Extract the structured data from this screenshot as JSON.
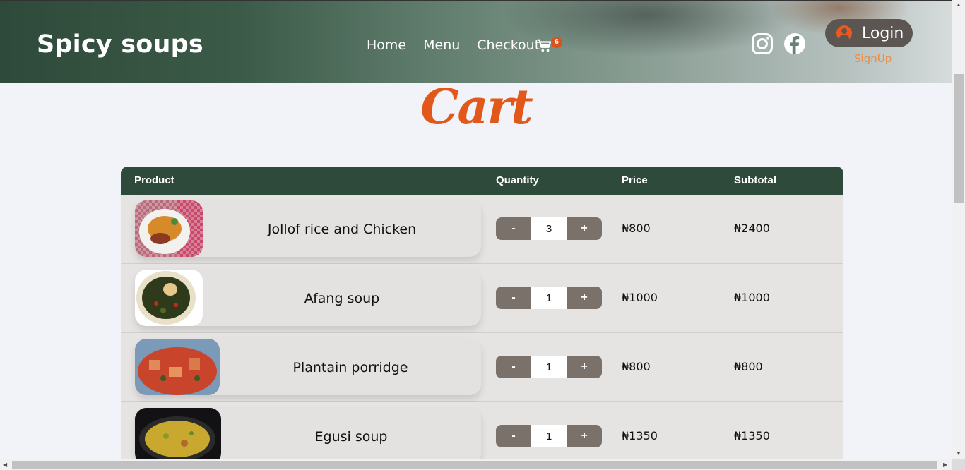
{
  "header": {
    "brand": "Spicy soups",
    "nav": [
      "Home",
      "Menu",
      "Checkout"
    ],
    "cart_count": "6",
    "login_label": "Login",
    "signup_label": "SignUp"
  },
  "page_title": "Cart",
  "table": {
    "headers": {
      "product": "Product",
      "quantity": "Quantity",
      "price": "Price",
      "subtotal": "Subtotal"
    },
    "minus_label": "-",
    "plus_label": "+",
    "rows": [
      {
        "name": "Jollof rice and Chicken",
        "qty": "3",
        "price": "₦800",
        "subtotal": "₦2400"
      },
      {
        "name": "Afang soup",
        "qty": "1",
        "price": "₦1000",
        "subtotal": "₦1000"
      },
      {
        "name": "Plantain porridge",
        "qty": "1",
        "price": "₦800",
        "subtotal": "₦800"
      },
      {
        "name": "Egusi soup",
        "qty": "1",
        "price": "₦1350",
        "subtotal": "₦1350"
      }
    ]
  },
  "colors": {
    "header_green": "#2e4a3a",
    "accent_orange": "#e2581a",
    "row_bg": "#e6e4e2",
    "qty_button": "#7a716b"
  }
}
